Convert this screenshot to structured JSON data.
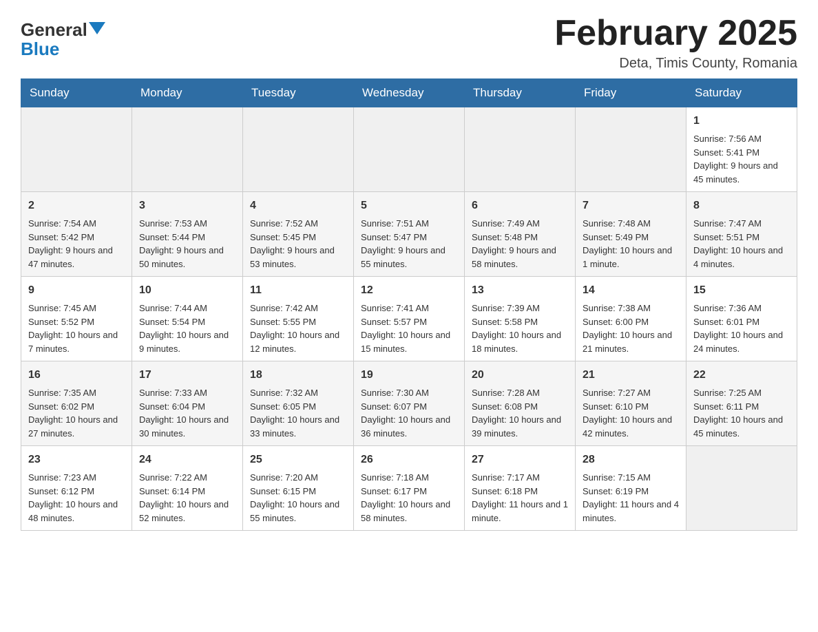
{
  "logo": {
    "text_general": "General",
    "text_blue": "Blue"
  },
  "header": {
    "title": "February 2025",
    "subtitle": "Deta, Timis County, Romania"
  },
  "days_of_week": [
    "Sunday",
    "Monday",
    "Tuesday",
    "Wednesday",
    "Thursday",
    "Friday",
    "Saturday"
  ],
  "weeks": [
    {
      "cells": [
        {
          "day": "",
          "info": ""
        },
        {
          "day": "",
          "info": ""
        },
        {
          "day": "",
          "info": ""
        },
        {
          "day": "",
          "info": ""
        },
        {
          "day": "",
          "info": ""
        },
        {
          "day": "",
          "info": ""
        },
        {
          "day": "1",
          "info": "Sunrise: 7:56 AM\nSunset: 5:41 PM\nDaylight: 9 hours and 45 minutes."
        }
      ]
    },
    {
      "cells": [
        {
          "day": "2",
          "info": "Sunrise: 7:54 AM\nSunset: 5:42 PM\nDaylight: 9 hours and 47 minutes."
        },
        {
          "day": "3",
          "info": "Sunrise: 7:53 AM\nSunset: 5:44 PM\nDaylight: 9 hours and 50 minutes."
        },
        {
          "day": "4",
          "info": "Sunrise: 7:52 AM\nSunset: 5:45 PM\nDaylight: 9 hours and 53 minutes."
        },
        {
          "day": "5",
          "info": "Sunrise: 7:51 AM\nSunset: 5:47 PM\nDaylight: 9 hours and 55 minutes."
        },
        {
          "day": "6",
          "info": "Sunrise: 7:49 AM\nSunset: 5:48 PM\nDaylight: 9 hours and 58 minutes."
        },
        {
          "day": "7",
          "info": "Sunrise: 7:48 AM\nSunset: 5:49 PM\nDaylight: 10 hours and 1 minute."
        },
        {
          "day": "8",
          "info": "Sunrise: 7:47 AM\nSunset: 5:51 PM\nDaylight: 10 hours and 4 minutes."
        }
      ]
    },
    {
      "cells": [
        {
          "day": "9",
          "info": "Sunrise: 7:45 AM\nSunset: 5:52 PM\nDaylight: 10 hours and 7 minutes."
        },
        {
          "day": "10",
          "info": "Sunrise: 7:44 AM\nSunset: 5:54 PM\nDaylight: 10 hours and 9 minutes."
        },
        {
          "day": "11",
          "info": "Sunrise: 7:42 AM\nSunset: 5:55 PM\nDaylight: 10 hours and 12 minutes."
        },
        {
          "day": "12",
          "info": "Sunrise: 7:41 AM\nSunset: 5:57 PM\nDaylight: 10 hours and 15 minutes."
        },
        {
          "day": "13",
          "info": "Sunrise: 7:39 AM\nSunset: 5:58 PM\nDaylight: 10 hours and 18 minutes."
        },
        {
          "day": "14",
          "info": "Sunrise: 7:38 AM\nSunset: 6:00 PM\nDaylight: 10 hours and 21 minutes."
        },
        {
          "day": "15",
          "info": "Sunrise: 7:36 AM\nSunset: 6:01 PM\nDaylight: 10 hours and 24 minutes."
        }
      ]
    },
    {
      "cells": [
        {
          "day": "16",
          "info": "Sunrise: 7:35 AM\nSunset: 6:02 PM\nDaylight: 10 hours and 27 minutes."
        },
        {
          "day": "17",
          "info": "Sunrise: 7:33 AM\nSunset: 6:04 PM\nDaylight: 10 hours and 30 minutes."
        },
        {
          "day": "18",
          "info": "Sunrise: 7:32 AM\nSunset: 6:05 PM\nDaylight: 10 hours and 33 minutes."
        },
        {
          "day": "19",
          "info": "Sunrise: 7:30 AM\nSunset: 6:07 PM\nDaylight: 10 hours and 36 minutes."
        },
        {
          "day": "20",
          "info": "Sunrise: 7:28 AM\nSunset: 6:08 PM\nDaylight: 10 hours and 39 minutes."
        },
        {
          "day": "21",
          "info": "Sunrise: 7:27 AM\nSunset: 6:10 PM\nDaylight: 10 hours and 42 minutes."
        },
        {
          "day": "22",
          "info": "Sunrise: 7:25 AM\nSunset: 6:11 PM\nDaylight: 10 hours and 45 minutes."
        }
      ]
    },
    {
      "cells": [
        {
          "day": "23",
          "info": "Sunrise: 7:23 AM\nSunset: 6:12 PM\nDaylight: 10 hours and 48 minutes."
        },
        {
          "day": "24",
          "info": "Sunrise: 7:22 AM\nSunset: 6:14 PM\nDaylight: 10 hours and 52 minutes."
        },
        {
          "day": "25",
          "info": "Sunrise: 7:20 AM\nSunset: 6:15 PM\nDaylight: 10 hours and 55 minutes."
        },
        {
          "day": "26",
          "info": "Sunrise: 7:18 AM\nSunset: 6:17 PM\nDaylight: 10 hours and 58 minutes."
        },
        {
          "day": "27",
          "info": "Sunrise: 7:17 AM\nSunset: 6:18 PM\nDaylight: 11 hours and 1 minute."
        },
        {
          "day": "28",
          "info": "Sunrise: 7:15 AM\nSunset: 6:19 PM\nDaylight: 11 hours and 4 minutes."
        },
        {
          "day": "",
          "info": ""
        }
      ]
    }
  ]
}
